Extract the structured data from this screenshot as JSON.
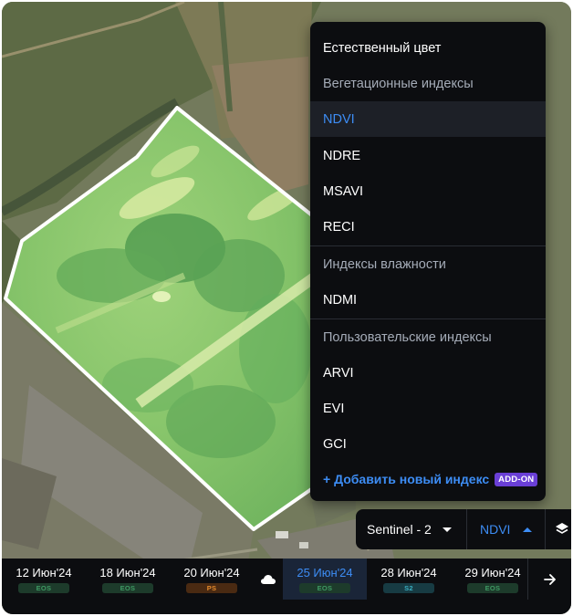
{
  "layer_menu": {
    "natural_color": "Естественный цвет",
    "vegetation_header": "Вегетационные индексы",
    "vegetation_items": [
      "NDVI",
      "NDRE",
      "MSAVI",
      "RECI"
    ],
    "moisture_header": "Индексы влажности",
    "moisture_items": [
      "NDMI"
    ],
    "custom_header": "Пользовательские индексы",
    "custom_items": [
      "ARVI",
      "EVI",
      "GCI"
    ],
    "selected": "NDVI",
    "add_index": "+ Добавить новый индекс",
    "addon_badge": "ADD-ON"
  },
  "selector": {
    "source": "Sentinel - 2",
    "index": "NDVI"
  },
  "timeline": {
    "items": [
      {
        "date": "12 Июн'24",
        "source": "EOS"
      },
      {
        "date": "18 Июн'24",
        "source": "EOS"
      },
      {
        "date": "20 Июн'24",
        "source": "PS",
        "cloudy": true
      },
      {
        "date": "25 Июн'24",
        "source": "EOS",
        "active": true
      },
      {
        "date": "28 Июн'24",
        "source": "S2"
      },
      {
        "date": "29 Июн'24",
        "source": "EOS"
      }
    ]
  },
  "colors": {
    "accent": "#3d8df5",
    "menu_bg": "#0c0d10",
    "field_light": "#cfe69a",
    "field_mid": "#8cc96a",
    "field_dark": "#4f9a4f",
    "field_border": "#ffffff",
    "addon": "#6a3fd6"
  },
  "icons": {
    "cloud": "cloud-icon",
    "next": "arrow-right-icon",
    "layers": "layers-icon",
    "dropdown": "caret-down-icon",
    "dropup": "caret-up-icon"
  }
}
